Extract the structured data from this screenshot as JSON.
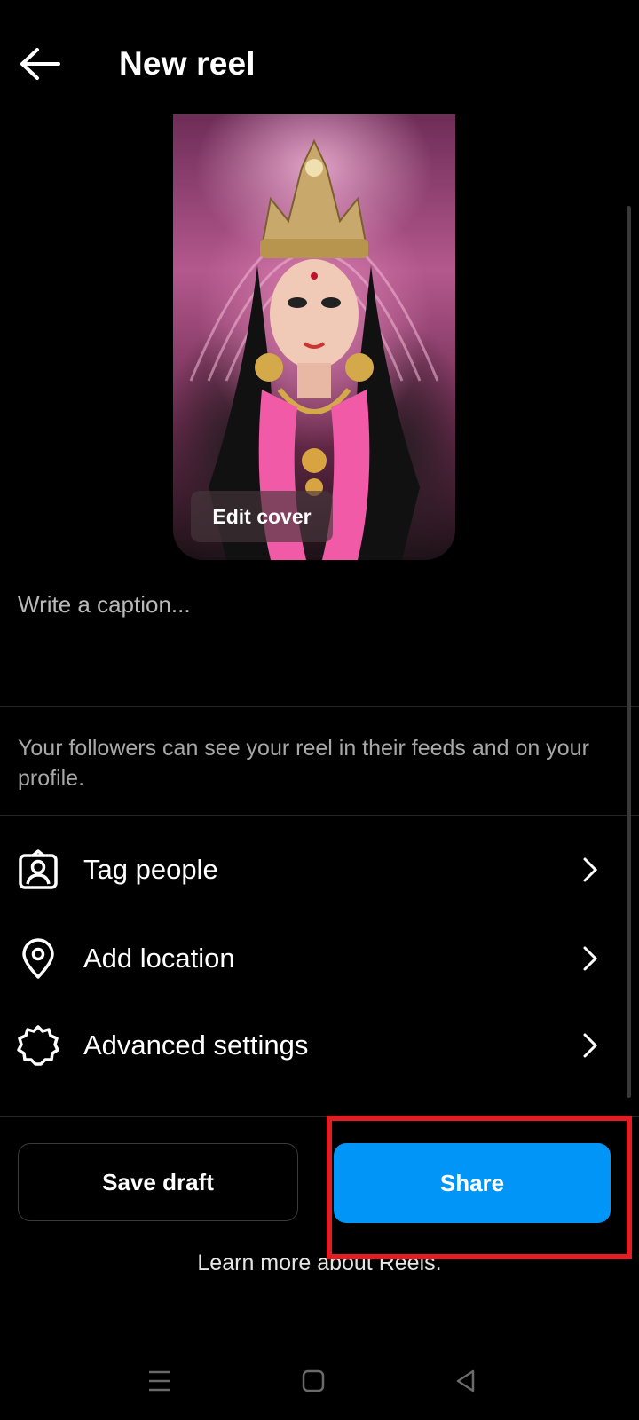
{
  "header": {
    "title": "New reel",
    "back_icon": "arrow-left-icon"
  },
  "cover": {
    "edit_label": "Edit cover"
  },
  "caption": {
    "placeholder": "Write a caption..."
  },
  "info": {
    "text": "Your followers can see your reel in their feeds and on your profile."
  },
  "options": [
    {
      "label": "Tag people",
      "icon": "tag-person-icon"
    },
    {
      "label": "Add location",
      "icon": "location-pin-icon"
    },
    {
      "label": "Advanced settings",
      "icon": "settings-gear-icon"
    }
  ],
  "actions": {
    "save_draft": "Save draft",
    "share": "Share",
    "learn_more": "Learn more about Reels."
  },
  "colors": {
    "background": "#000000",
    "share_button": "#0095f6",
    "highlight_box": "#e21d24",
    "muted_text": "#a8a8a8"
  },
  "system_nav": [
    "menu-icon",
    "home-square-icon",
    "back-triangle-icon"
  ]
}
